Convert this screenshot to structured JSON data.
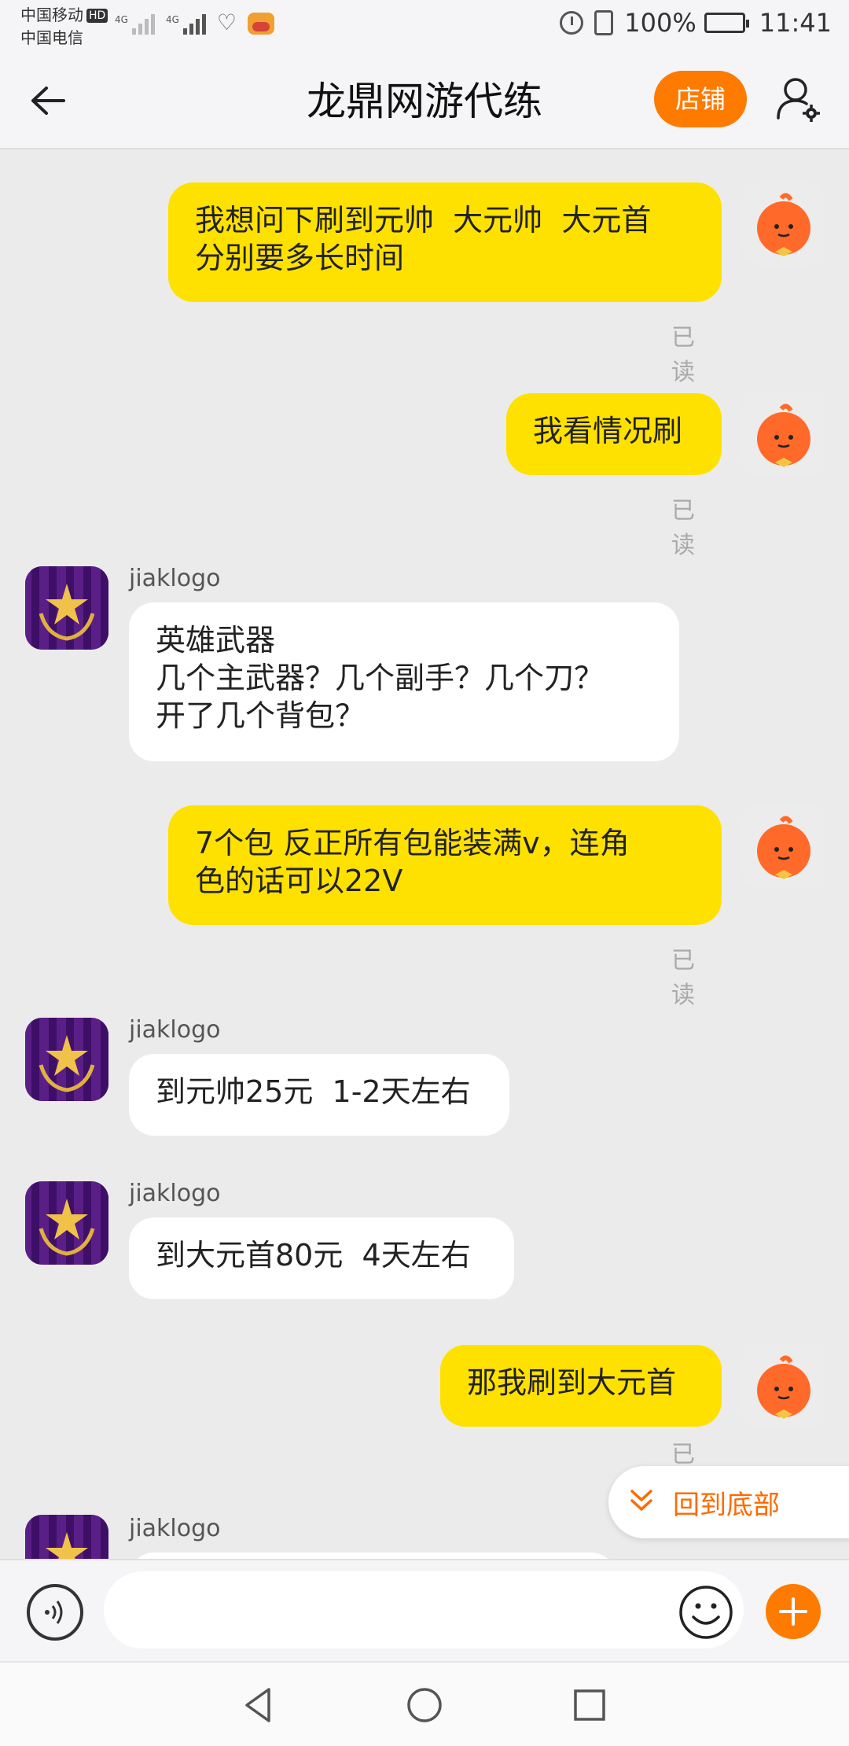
{
  "status_bar": {
    "carrier1": "中国移动",
    "carrier2": "中国电信",
    "hd": "HD",
    "network1": "4G",
    "network2": "4G",
    "battery": "100%",
    "time": "11:41"
  },
  "header": {
    "title": "龙鼎网游代练",
    "shop_label": "店铺"
  },
  "messages": [
    {
      "side": "me",
      "text": "我想问下刷到元帅  大元帅  大元首\n分别要多长时间",
      "status": "已读"
    },
    {
      "side": "me",
      "text": "我看情况刷",
      "status": "已读"
    },
    {
      "side": "them",
      "sender": "jiaklogo",
      "text": "英雄武器\n几个主武器？几个副手？几个刀？\n开了几个背包？"
    },
    {
      "side": "me",
      "text": "7个包 反正所有包能装满v，连角\n色的话可以22V",
      "status": "已读"
    },
    {
      "side": "them",
      "sender": "jiaklogo",
      "text": "到元帅25元  1-2天左右"
    },
    {
      "side": "them",
      "sender": "jiaklogo",
      "text": "到大元首80元  4天左右"
    },
    {
      "side": "me",
      "text": "那我刷到大元首",
      "status": "已读"
    },
    {
      "side": "them",
      "sender": "jiaklogo",
      "text": ""
    }
  ],
  "scroll_bottom_label": "回到底部",
  "input": {
    "placeholder": ""
  },
  "colors": {
    "accent": "#ff7b00",
    "my_bubble": "#ffe100",
    "their_bubble": "#ffffff",
    "background": "#ebebeb"
  },
  "icons": {
    "back": "arrow-left-icon",
    "user_settings": "user-gear-icon",
    "voice": "voice-icon",
    "emoji": "smiley-icon",
    "plus": "plus-icon",
    "nav_back": "triangle-back-icon",
    "nav_home": "circle-home-icon",
    "nav_recent": "square-recent-icon"
  }
}
